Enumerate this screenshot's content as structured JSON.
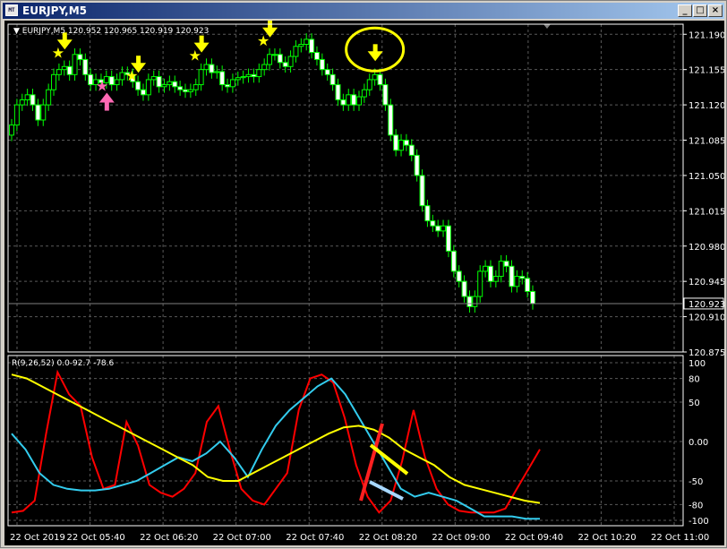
{
  "window": {
    "title": "EURJPY,M5",
    "icon_label": "MT",
    "buttons": [
      "minimize-button",
      "maximize-button",
      "close-button"
    ]
  },
  "colors": {
    "background": "#000000",
    "grid": "#5a5a5a",
    "candle_up": "#000000",
    "candle_down": "#ffffff",
    "wick": "#00ff00",
    "rsi_line": "#ff0000",
    "fast_line": "#33ccee",
    "slow_line": "#ffff00",
    "star_yellow": "#ffff00",
    "star_pink": "#ff69b4",
    "annotation_circle": "#ffff00"
  },
  "price_panel": {
    "symbol_label": "EURJPY,M5",
    "ohlc": "120.952 120.965 120.919 120.923",
    "y_ticks": [
      "121.190",
      "121.155",
      "121.120",
      "121.085",
      "121.050",
      "121.015",
      "120.980",
      "120.945",
      "120.910",
      "120.875"
    ],
    "current_price": "120.923",
    "annotations": [
      "yellow-star-down-arrow x4",
      "pink-star-up-arrow",
      "yellow-circle-down-arrow"
    ]
  },
  "indicator_panel": {
    "label": "R(9,26,52) 0.0-92.7 -78.6",
    "y_ticks": [
      "100",
      "80",
      "50",
      "0.00",
      "-50",
      "-80",
      "-100"
    ]
  },
  "x_axis": {
    "labels": [
      "22 Oct 2019",
      "22 Oct 05:40",
      "22 Oct 06:20",
      "22 Oct 07:00",
      "22 Oct 07:40",
      "22 Oct 08:20",
      "22 Oct 09:00",
      "22 Oct 09:40",
      "22 Oct 10:20",
      "22 Oct 11:00"
    ]
  },
  "chart_data": [
    {
      "type": "candlestick",
      "title": "EURJPY,M5",
      "ohlc_header": "120.952 120.965 120.919 120.923",
      "ylim": [
        120.875,
        121.2
      ],
      "y_ticks": [
        121.19,
        121.155,
        121.12,
        121.085,
        121.05,
        121.015,
        120.98,
        120.945,
        120.91,
        120.875
      ],
      "x_labels": [
        "22 Oct 2019",
        "22 Oct 05:40",
        "22 Oct 06:20",
        "22 Oct 07:00",
        "22 Oct 07:40",
        "22 Oct 08:20",
        "22 Oct 09:00",
        "22 Oct 09:40",
        "22 Oct 10:20",
        "22 Oct 11:00"
      ],
      "close_series": [
        121.1,
        121.12,
        121.125,
        121.13,
        121.12,
        121.105,
        121.12,
        121.135,
        121.15,
        121.155,
        121.158,
        121.15,
        121.17,
        121.165,
        121.15,
        121.14,
        121.145,
        121.142,
        121.148,
        121.14,
        121.145,
        121.152,
        121.15,
        121.143,
        121.135,
        121.13,
        121.145,
        121.148,
        121.138,
        121.14,
        121.143,
        121.138,
        121.135,
        121.133,
        121.135,
        121.14,
        121.155,
        121.16,
        121.152,
        121.153,
        121.14,
        121.138,
        121.145,
        121.147,
        121.148,
        121.15,
        121.148,
        121.155,
        121.16,
        121.17,
        121.17,
        121.162,
        121.158,
        121.168,
        121.178,
        121.18,
        121.185,
        121.172,
        121.165,
        121.155,
        121.15,
        121.14,
        121.125,
        121.12,
        121.13,
        121.12,
        121.128,
        121.135,
        121.145,
        121.15,
        121.14,
        121.12,
        121.09,
        121.075,
        121.085,
        121.08,
        121.07,
        121.05,
        121.02,
        121.005,
        121.0,
        120.995,
        121.0,
        120.975,
        120.955,
        120.945,
        120.93,
        120.92,
        120.93,
        120.955,
        120.96,
        120.945,
        120.95,
        120.965,
        120.96,
        120.94,
        120.95,
        120.948,
        120.935,
        120.923
      ],
      "current_price": 120.923,
      "markers": [
        {
          "type": "sell-signal",
          "index": 10
        },
        {
          "type": "buy-signal",
          "index": 18
        },
        {
          "type": "sell-signal",
          "index": 24
        },
        {
          "type": "sell-signal",
          "index": 36
        },
        {
          "type": "sell-signal",
          "index": 49
        },
        {
          "type": "sell-signal-circled",
          "index": 69
        }
      ]
    },
    {
      "type": "line",
      "label": "R(9,26,52) 0.0-92.7 -78.6",
      "ylim": [
        -100,
        100
      ],
      "y_ticks": [
        100,
        80,
        50,
        0,
        -50,
        -80,
        -100
      ],
      "series": [
        {
          "name": "R9",
          "color": "#ff0000",
          "values": [
            -90,
            -88,
            -75,
            10,
            88,
            60,
            45,
            -20,
            -60,
            -55,
            25,
            -5,
            -55,
            -65,
            -70,
            -60,
            -40,
            25,
            45,
            -10,
            -60,
            -75,
            -80,
            -60,
            -40,
            40,
            80,
            85,
            75,
            30,
            -30,
            -70,
            -90,
            -75,
            -25,
            40,
            -20,
            -60,
            -80,
            -88,
            -90,
            -90,
            -90,
            -85,
            -60,
            -35,
            -10
          ]
        },
        {
          "name": "R26",
          "color": "#33ccee",
          "values": [
            10,
            -10,
            -40,
            -55,
            -60,
            -62,
            -62,
            -60,
            -55,
            -50,
            -40,
            -30,
            -20,
            -25,
            -15,
            0,
            -20,
            -45,
            -10,
            20,
            40,
            55,
            70,
            80,
            60,
            30,
            0,
            -30,
            -60,
            -70,
            -65,
            -70,
            -75,
            -85,
            -95,
            -95,
            -95,
            -98,
            -98
          ]
        },
        {
          "name": "R52",
          "color": "#ffff00",
          "values": [
            85,
            80,
            70,
            60,
            50,
            40,
            30,
            20,
            10,
            0,
            -10,
            -20,
            -30,
            -45,
            -50,
            -50,
            -40,
            -30,
            -20,
            -10,
            0,
            10,
            18,
            20,
            15,
            5,
            -10,
            -20,
            -30,
            -45,
            -55,
            -60,
            -65,
            -70,
            -75,
            -78
          ]
        }
      ]
    }
  ]
}
